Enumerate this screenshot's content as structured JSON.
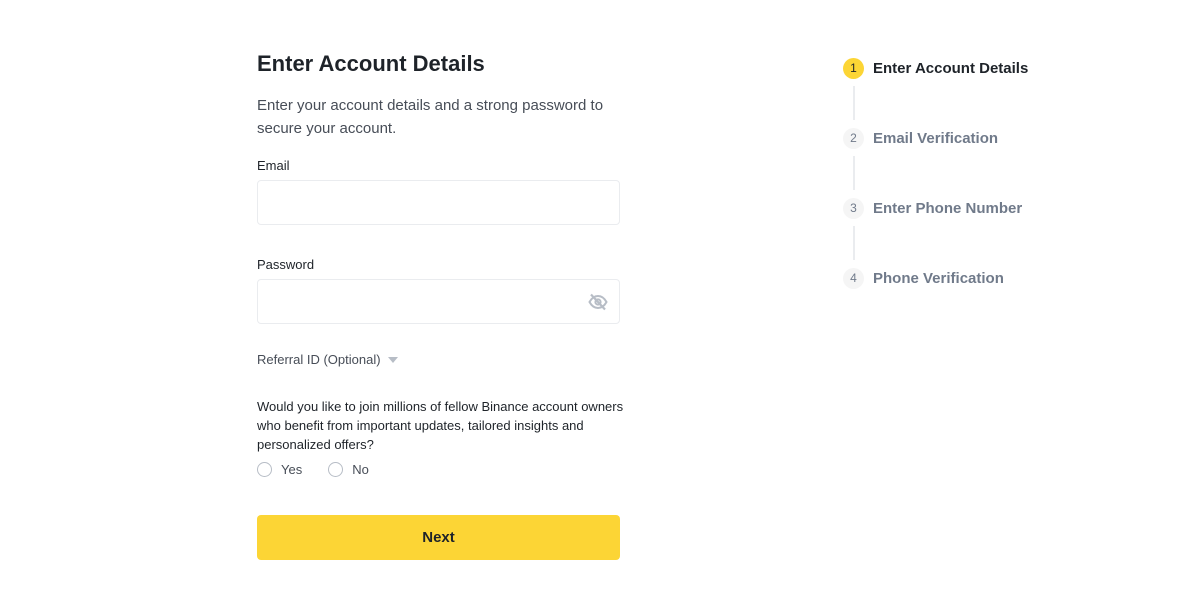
{
  "form": {
    "title": "Enter Account Details",
    "subtitle": "Enter your account details and a strong password to secure your account.",
    "email": {
      "label": "Email",
      "value": "",
      "placeholder": ""
    },
    "password": {
      "label": "Password",
      "value": "",
      "placeholder": "",
      "toggle_icon": "eye-off-icon"
    },
    "referral": {
      "label": "Referral ID (Optional)",
      "icon": "caret-down-icon"
    },
    "question": "Would you like to join millions of fellow Binance account owners who benefit from important updates, tailored insights and personalized offers?",
    "options": [
      {
        "label": "Yes"
      },
      {
        "label": "No"
      }
    ],
    "next_label": "Next"
  },
  "stepper": {
    "steps": [
      {
        "number": "1",
        "label": "Enter Account Details"
      },
      {
        "number": "2",
        "label": "Email Verification"
      },
      {
        "number": "3",
        "label": "Enter Phone Number"
      },
      {
        "number": "4",
        "label": "Phone Verification"
      }
    ],
    "active_step": 1
  },
  "colors": {
    "accent": "#fcd535",
    "text_primary": "#1e2329",
    "text_secondary": "#707a8a",
    "border": "#eaecef"
  }
}
